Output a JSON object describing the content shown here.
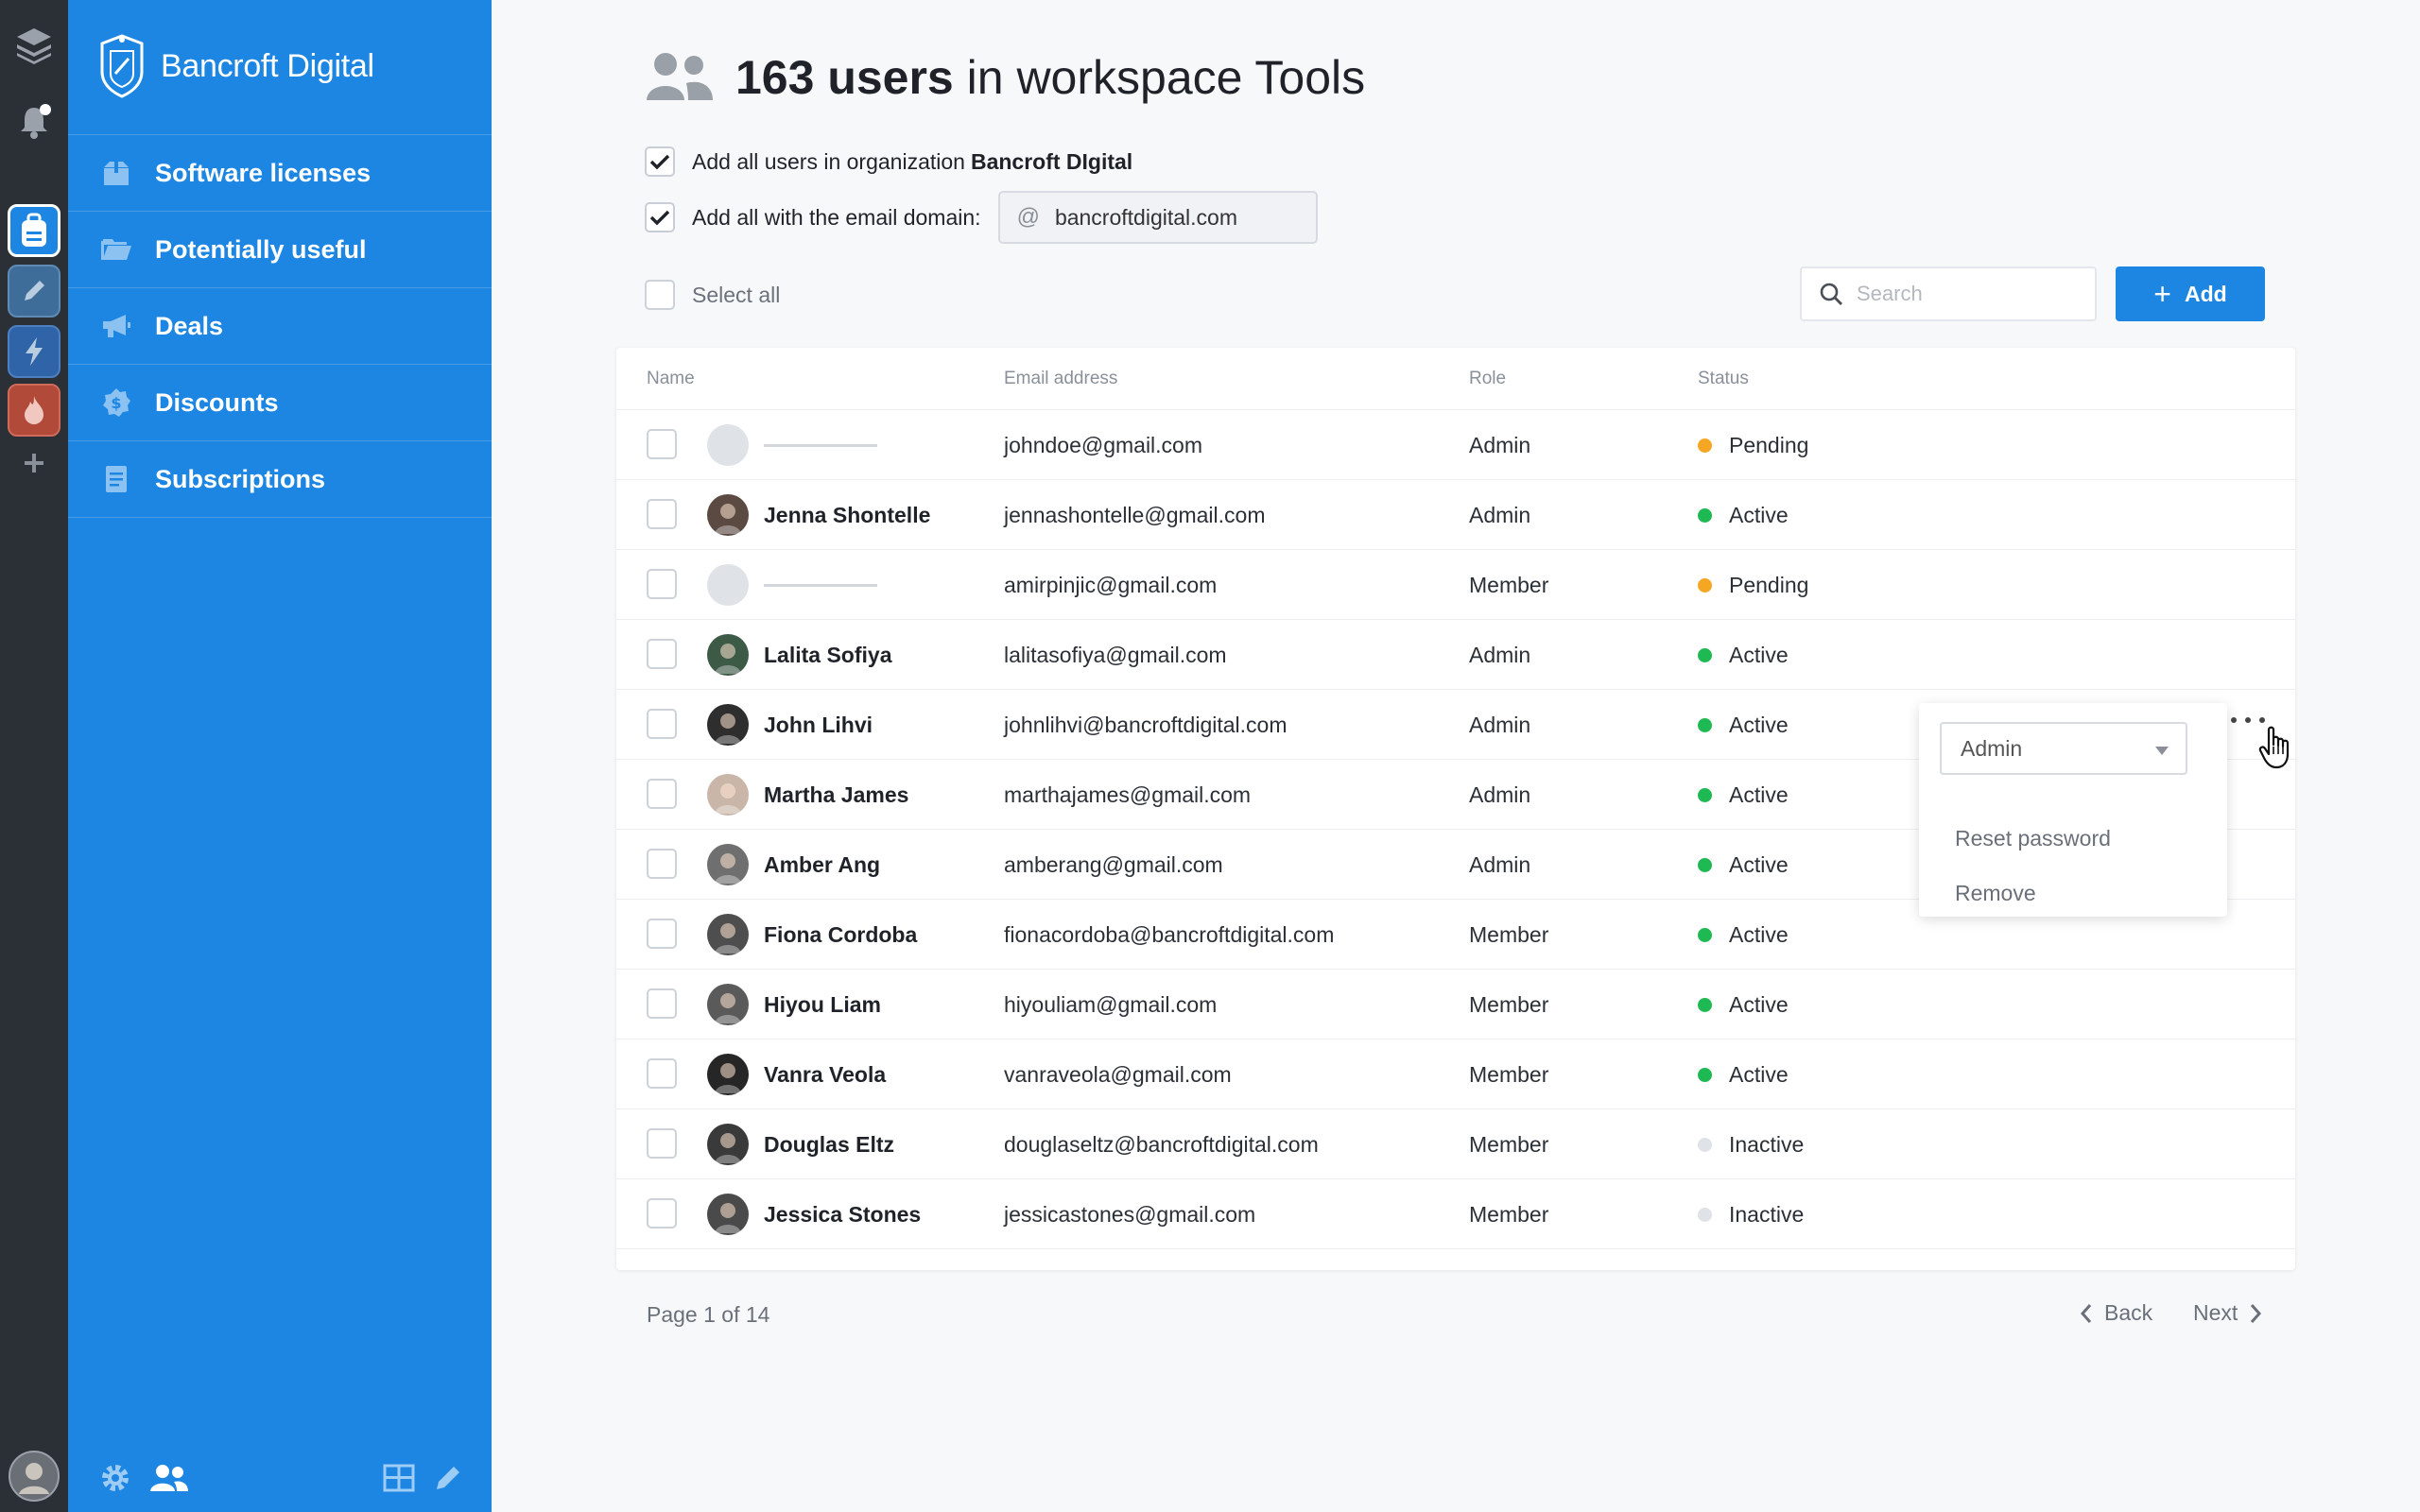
{
  "rail": {
    "icons": [
      "layers-icon",
      "bell-icon",
      "backpack-icon",
      "pencil-icon",
      "lightning-icon",
      "flame-icon",
      "plus-icon",
      "user-avatar"
    ],
    "colors": {
      "bg": "#2b2f36",
      "active": "#1d86e3",
      "pencil": "#3e6d9a",
      "lightning": "#2f64a8",
      "flame": "#b24a3a"
    }
  },
  "sidebar": {
    "brand": "Bancroft Digital",
    "items": [
      {
        "label": "Software licenses",
        "icon": "box-icon"
      },
      {
        "label": "Potentially useful",
        "icon": "folder-icon"
      },
      {
        "label": "Deals",
        "icon": "megaphone-icon"
      },
      {
        "label": "Discounts",
        "icon": "dollar-badge-icon"
      },
      {
        "label": "Subscriptions",
        "icon": "document-icon"
      }
    ],
    "bottom_icons": [
      "gear-icon",
      "users-icon",
      "grid-icon",
      "pencil-icon"
    ],
    "color": "#1d86e3"
  },
  "header": {
    "count": "163 users",
    "suffix": " in workspace Tools"
  },
  "options": {
    "org_label": "Add all users in organization",
    "org_name": "Bancroft DIgital",
    "org_checked": true,
    "domain_label": "Add all with the email domain:",
    "domain_checked": true,
    "domain_at": "@",
    "domain_value": "bancroftdigital.com"
  },
  "toolbar": {
    "select_all": "Select all",
    "search_placeholder": "Search",
    "add_label": "Add"
  },
  "table": {
    "columns": [
      "Name",
      "Email address",
      "Role",
      "Status"
    ],
    "rows": [
      {
        "name": "",
        "email": "johndoe@gmail.com",
        "role": "Admin",
        "status": "Pending"
      },
      {
        "name": "Jenna Shontelle",
        "email": "jennashontelle@gmail.com",
        "role": "Admin",
        "status": "Active"
      },
      {
        "name": "",
        "email": "amirpinjic@gmail.com",
        "role": "Member",
        "status": "Pending"
      },
      {
        "name": "Lalita Sofiya",
        "email": "lalitasofiya@gmail.com",
        "role": "Admin",
        "status": "Active"
      },
      {
        "name": "John Lihvi",
        "email": "johnlihvi@bancroftdigital.com",
        "role": "Admin",
        "status": "Active"
      },
      {
        "name": "Martha James",
        "email": "marthajames@gmail.com",
        "role": "Admin",
        "status": "Active"
      },
      {
        "name": "Amber Ang",
        "email": "amberang@gmail.com",
        "role": "Admin",
        "status": "Active"
      },
      {
        "name": "Fiona Cordoba",
        "email": "fionacordoba@bancroftdigital.com",
        "role": "Member",
        "status": "Active"
      },
      {
        "name": "Hiyou Liam",
        "email": "hiyouliam@gmail.com",
        "role": "Member",
        "status": "Active"
      },
      {
        "name": "Vanra Veola",
        "email": "vanraveola@gmail.com",
        "role": "Member",
        "status": "Active"
      },
      {
        "name": "Douglas Eltz",
        "email": "douglaseltz@bancroftdigital.com",
        "role": "Member",
        "status": "Inactive"
      },
      {
        "name": "Jessica Stones",
        "email": "jessicastones@gmail.com",
        "role": "Member",
        "status": "Inactive"
      }
    ],
    "status_colors": {
      "Pending": "#f5a623",
      "Active": "#1fb954",
      "Inactive": "#dfe2e6"
    },
    "avatar_colors": [
      "#dfe2e6",
      "#5b4a42",
      "#dfe2e6",
      "#3d5a46",
      "#2e2e2e",
      "#c9b6a8",
      "#6f6f6f",
      "#4e4e4e",
      "#5a5a5a",
      "#262626",
      "#3a3a3a",
      "#4a4a4a"
    ]
  },
  "row_menu": {
    "role_value": "Admin",
    "items": [
      "Reset password",
      "Remove"
    ]
  },
  "pagination": {
    "label": "Page 1 of 14",
    "back": "Back",
    "next": "Next"
  }
}
